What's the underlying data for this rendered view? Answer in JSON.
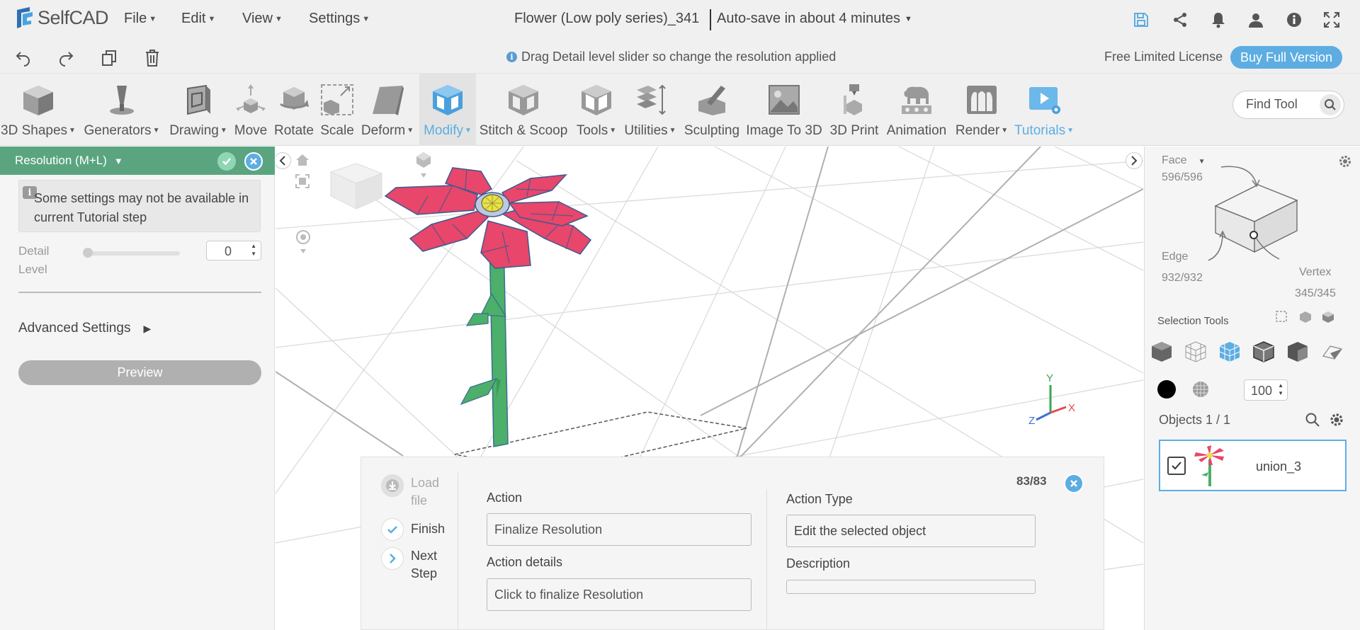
{
  "app": {
    "name": "SelfCAD"
  },
  "menu": [
    {
      "label": "File"
    },
    {
      "label": "Edit"
    },
    {
      "label": "View"
    },
    {
      "label": "Settings"
    }
  ],
  "document": {
    "title": "Flower (Low poly series)_341",
    "autosave": "Auto-save in about 4 minutes"
  },
  "top_icons": [
    "save-icon",
    "share-icon",
    "bell-icon",
    "user-icon",
    "info-icon",
    "fullscreen-icon"
  ],
  "action_bar": {
    "hint": "Drag Detail level slider so change the resolution applied",
    "license": "Free Limited License",
    "buy_label": "Buy Full Version"
  },
  "tools": [
    {
      "label": "3D Shapes",
      "dropdown": true
    },
    {
      "label": "Generators",
      "dropdown": true
    },
    {
      "label": "Drawing",
      "dropdown": true
    },
    {
      "label": "Move",
      "dropdown": false
    },
    {
      "label": "Rotate",
      "dropdown": false
    },
    {
      "label": "Scale",
      "dropdown": false
    },
    {
      "label": "Deform",
      "dropdown": true
    },
    {
      "label": "Modify",
      "dropdown": true,
      "active": true
    },
    {
      "label": "Stitch & Scoop",
      "dropdown": false
    },
    {
      "label": "Tools",
      "dropdown": true
    },
    {
      "label": "Utilities",
      "dropdown": true
    },
    {
      "label": "Sculpting",
      "dropdown": false
    },
    {
      "label": "Image To 3D",
      "dropdown": false
    },
    {
      "label": "3D Print",
      "dropdown": false
    },
    {
      "label": "Animation",
      "dropdown": false
    },
    {
      "label": "Render",
      "dropdown": true
    },
    {
      "label": "Tutorials",
      "dropdown": true
    }
  ],
  "find_tool": {
    "placeholder": "Find Tool"
  },
  "left_panel": {
    "title": "Resolution (M+L)",
    "notice": "Some settings may not be available in current Tutorial step",
    "detail_label": "Detail Level",
    "detail_value": "0",
    "advanced_label": "Advanced Settings",
    "preview_label": "Preview"
  },
  "tutorial": {
    "step_count": "83/83",
    "steps": [
      {
        "label": "Load file"
      },
      {
        "label": "Finish"
      },
      {
        "label": "Next Step"
      }
    ],
    "action_label": "Action",
    "action_value": "Finalize Resolution",
    "action_details_label": "Action details",
    "action_details_value": "Click to finalize Resolution",
    "action_type_label": "Action Type",
    "action_type_value": "Edit the selected object",
    "description_label": "Description",
    "description_value": ""
  },
  "right_panel": {
    "face_label": "Face",
    "face_count": "596/596",
    "edge_label": "Edge",
    "edge_count": "932/932",
    "vertex_label": "Vertex",
    "vertex_count": "345/345",
    "selection_tools_label": "Selection Tools",
    "opacity_value": "100",
    "objects_label": "Objects 1 / 1",
    "objects": [
      {
        "name": "union_3",
        "checked": true
      }
    ]
  },
  "axis": {
    "x": "X",
    "y": "Y",
    "z": "Z"
  },
  "colors": {
    "accent": "#5dade2",
    "panel_header": "#5aa580",
    "petal": "#e8466a",
    "stem": "#4caf6a"
  }
}
